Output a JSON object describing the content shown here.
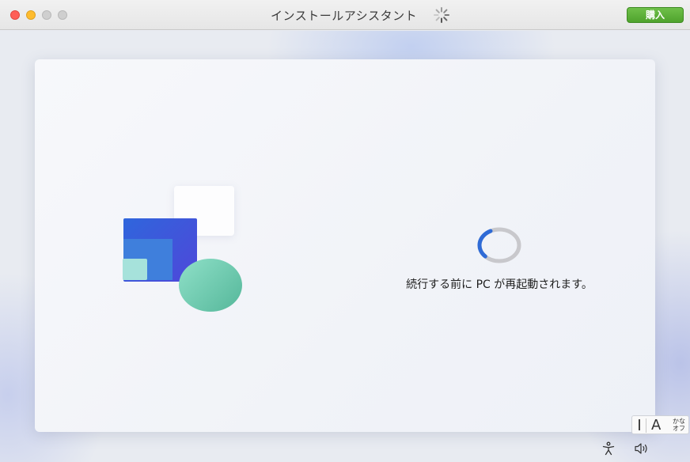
{
  "window": {
    "title": "インストールアシスタント",
    "buy_label": "購入"
  },
  "setup": {
    "message": "続行する前に PC が再起動されます。"
  },
  "ime": {
    "mode_char": "A",
    "kana_line1": "かな",
    "kana_line2": "オフ"
  },
  "icons": {
    "title_spinner": "activity-spinner-icon",
    "loading": "loading-ring-icon",
    "accessibility": "accessibility-icon",
    "volume": "volume-icon"
  },
  "colors": {
    "buy_button": "#5cb239",
    "ring_accent": "#2f6bd6",
    "ring_track": "#c8c8cc"
  }
}
